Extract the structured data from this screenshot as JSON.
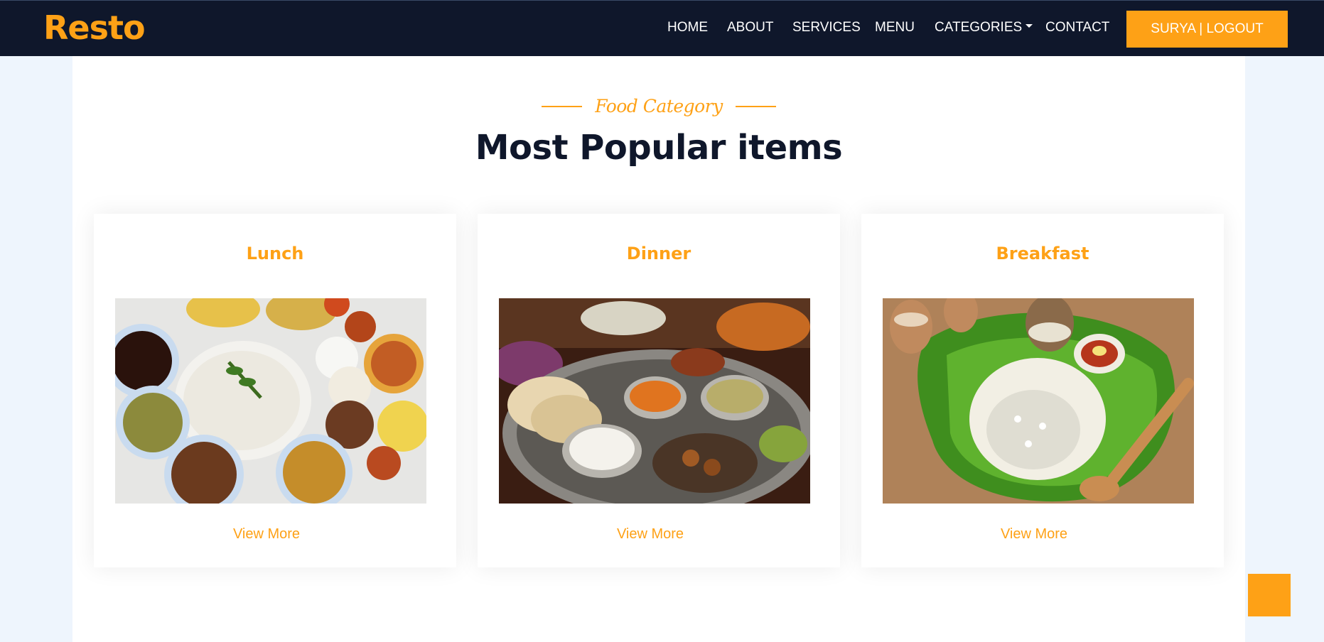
{
  "navbar": {
    "brand": "Resto",
    "links": [
      {
        "label": "HOME"
      },
      {
        "label": "ABOUT"
      },
      {
        "label": "SERVICES"
      },
      {
        "label": "MENU"
      },
      {
        "label": "CATEGORIES"
      },
      {
        "label": "CONTACT"
      }
    ],
    "logout_label": "SURYA | LOGOUT"
  },
  "section": {
    "tag": "Food Category",
    "title": "Most Popular items"
  },
  "cards": [
    {
      "title": "Lunch",
      "link": "View More"
    },
    {
      "title": "Dinner",
      "link": "View More"
    },
    {
      "title": "Breakfast",
      "link": "View More"
    }
  ],
  "colors": {
    "accent": "#fea116",
    "dark": "#0f172b",
    "page_bg": "#eef5fd"
  },
  "icons": {
    "categories_dropdown": "caret-down-icon"
  }
}
